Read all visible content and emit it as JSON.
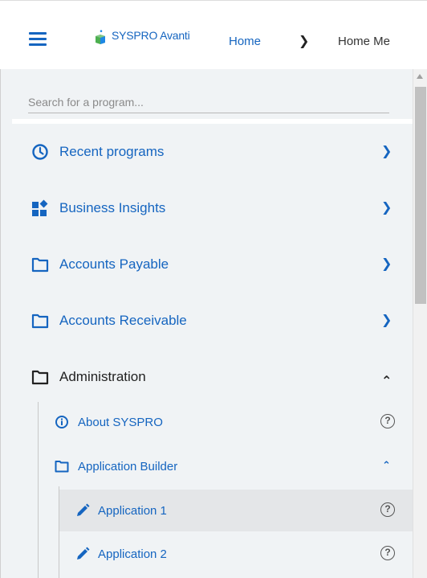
{
  "header": {
    "logo_text": "SYSPRO Avanti",
    "breadcrumb": {
      "home": "Home",
      "separator": "❯",
      "current": "Home Me"
    },
    "colors": {
      "accent": "#1565c0",
      "logo_green": "#4caf50",
      "logo_blue": "#1e88e5"
    }
  },
  "search": {
    "placeholder": "Search for a program..."
  },
  "nav": [
    {
      "label": "Recent programs",
      "icon": "clock-icon",
      "chevron": "❯"
    },
    {
      "label": "Business Insights",
      "icon": "dashboard-icon",
      "chevron": "❯"
    },
    {
      "label": "Accounts Payable",
      "icon": "folder-icon",
      "chevron": "❯"
    },
    {
      "label": "Accounts Receivable",
      "icon": "folder-icon",
      "chevron": "❯"
    },
    {
      "label": "Administration",
      "icon": "folder-icon",
      "chevron": "⌃"
    }
  ],
  "admin_children": [
    {
      "label": "About SYSPRO",
      "icon": "info-icon",
      "help": "?"
    },
    {
      "label": "Application Builder",
      "icon": "folder-icon",
      "chevron": "⌃"
    }
  ],
  "builder_children": [
    {
      "label": "Application 1",
      "icon": "pencil-icon",
      "help": "?",
      "selected": true
    },
    {
      "label": "Application 2",
      "icon": "pencil-icon",
      "help": "?",
      "selected": false
    }
  ]
}
